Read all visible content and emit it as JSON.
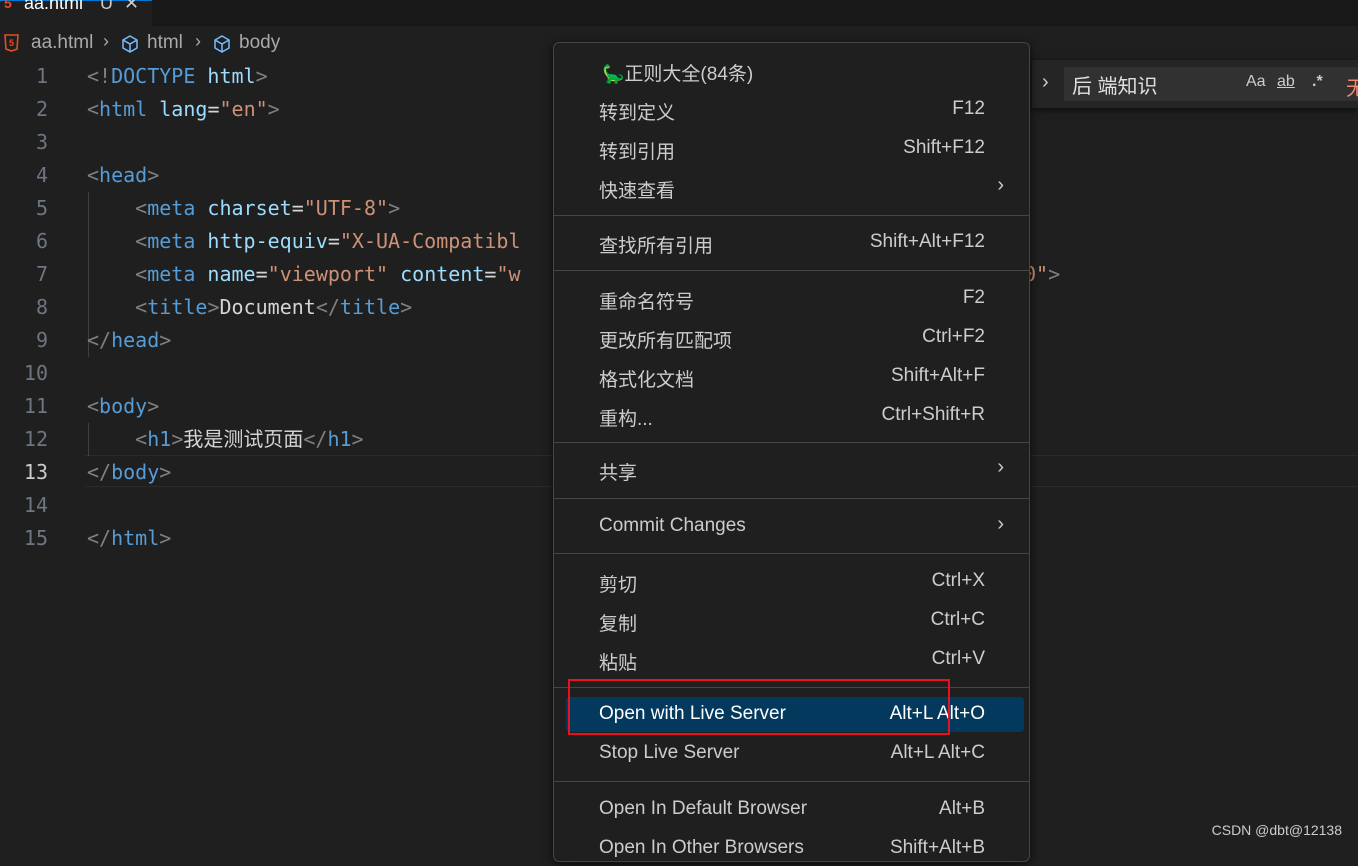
{
  "tab": {
    "label": "aa.html",
    "dirty": "U",
    "close": "✕",
    "icon": "html5-icon"
  },
  "breadcrumb": {
    "file": "aa.html",
    "items": [
      "html",
      "body"
    ],
    "sep": "›"
  },
  "editor": {
    "active_line": 13,
    "lines": [
      {
        "n": "1"
      },
      {
        "n": "2"
      },
      {
        "n": "3"
      },
      {
        "n": "4"
      },
      {
        "n": "5"
      },
      {
        "n": "6"
      },
      {
        "n": "7"
      },
      {
        "n": "8"
      },
      {
        "n": "9"
      },
      {
        "n": "10"
      },
      {
        "n": "11"
      },
      {
        "n": "12"
      },
      {
        "n": "13"
      },
      {
        "n": "14"
      },
      {
        "n": "15"
      }
    ],
    "code": {
      "l1a": "<!",
      "l1b": "DOCTYPE",
      "l1c": " html",
      "l1d": ">",
      "l2a": "<",
      "l2b": "html",
      "l2c": " lang",
      "l2d": "=",
      "l2e": "\"en\"",
      "l2f": ">",
      "l4a": "<",
      "l4b": "head",
      "l4c": ">",
      "l5a": "<",
      "l5b": "meta",
      "l5c": " charset",
      "l5d": "=",
      "l5e": "\"UTF-8\"",
      "l5f": ">",
      "l6a": "<",
      "l6b": "meta",
      "l6c": " http-equiv",
      "l6d": "=",
      "l6e": "\"X-UA-Compatibl",
      "l7a": "<",
      "l7b": "meta",
      "l7c": " name",
      "l7d": "=",
      "l7e": "\"viewport\"",
      "l7f": " content",
      "l7g": "=",
      "l7h": "\"w",
      "l7tail_s": "0\"",
      "l7tail_p": ">",
      "l8a": "<",
      "l8b": "title",
      "l8c": ">",
      "l8d": "Document",
      "l8e": "</",
      "l8f": "title",
      "l8g": ">",
      "l9a": "</",
      "l9b": "head",
      "l9c": ">",
      "l11a": "<",
      "l11b": "body",
      "l11c": ">",
      "l12a": "<",
      "l12b": "h1",
      "l12c": ">",
      "l12d": "我是测试页面",
      "l12e": "</",
      "l12f": "h1",
      "l12g": ">",
      "l13a": "</",
      "l13b": "body",
      "l13c": ">",
      "l15a": "</",
      "l15b": "html",
      "l15c": ">"
    }
  },
  "find_widget": {
    "value": "后 端知识",
    "match_case": "Aa",
    "whole_word": "ab",
    "regex": ".*",
    "no_results_glyph": "无"
  },
  "context_menu": {
    "items": [
      {
        "label": "正则大全(84条)",
        "key": "",
        "icon": "regex-extension-icon"
      },
      {
        "label": "转到定义",
        "key": "F12"
      },
      {
        "label": "转到引用",
        "key": "Shift+F12"
      },
      {
        "label": "快速查看",
        "key": "",
        "submenu": "›"
      },
      {
        "label": "查找所有引用",
        "key": "Shift+Alt+F12"
      },
      {
        "label": "重命名符号",
        "key": "F2"
      },
      {
        "label": "更改所有匹配项",
        "key": "Ctrl+F2"
      },
      {
        "label": "格式化文档",
        "key": "Shift+Alt+F"
      },
      {
        "label": "重构...",
        "key": "Ctrl+Shift+R"
      },
      {
        "label": "共享",
        "key": "",
        "submenu": "›"
      },
      {
        "label": "Commit Changes",
        "key": "",
        "submenu": "›"
      },
      {
        "label": "剪切",
        "key": "Ctrl+X"
      },
      {
        "label": "复制",
        "key": "Ctrl+C"
      },
      {
        "label": "粘贴",
        "key": "Ctrl+V"
      },
      {
        "label": "Open with Live Server",
        "key": "Alt+L Alt+O",
        "highlighted": true
      },
      {
        "label": "Stop Live Server",
        "key": "Alt+L Alt+C"
      },
      {
        "label": "Open In Default Browser",
        "key": "Alt+B"
      },
      {
        "label": "Open In Other Browsers",
        "key": "Shift+Alt+B"
      }
    ]
  },
  "watermark": "CSDN @dbt@12138",
  "colors": {
    "highlight": "#04395e",
    "annotation_box": "#e81123",
    "accent": "#0078d4"
  }
}
